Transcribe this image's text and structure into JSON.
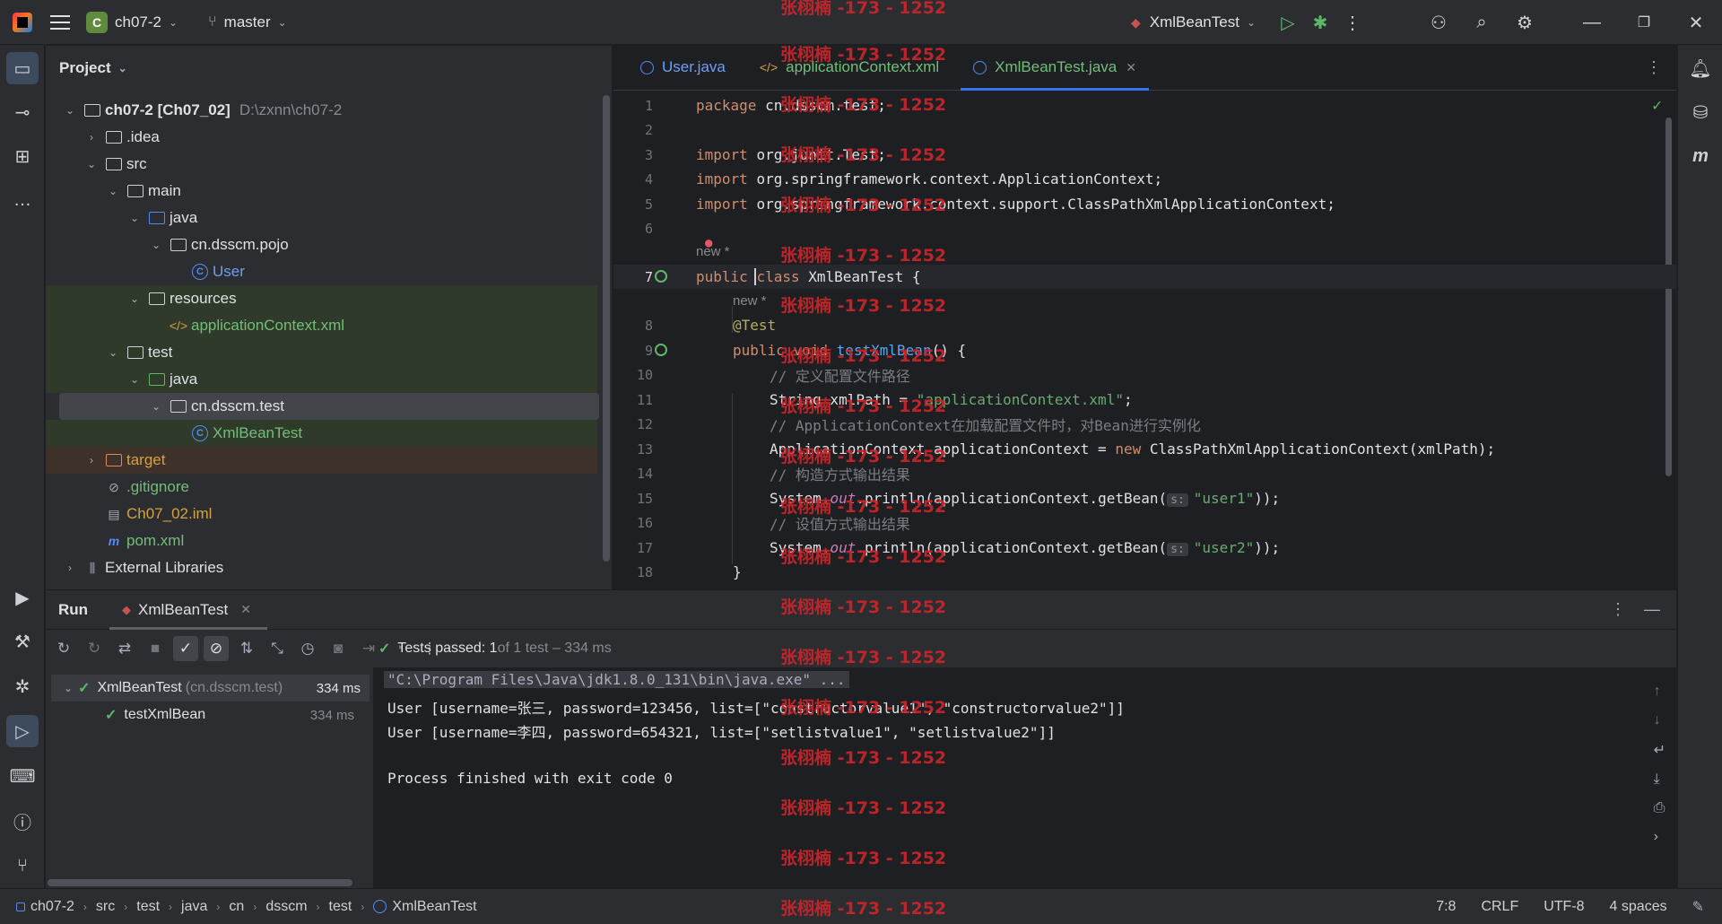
{
  "titlebar": {
    "project_badge": "C",
    "project_name": "ch07-2",
    "branch": "master",
    "run_config": "XmlBeanTest"
  },
  "project_panel": {
    "title": "Project",
    "tree": [
      {
        "label": "ch07-2 [Ch07_02]",
        "extra": "D:\\zxnn\\ch07-2"
      },
      {
        "label": ".idea"
      },
      {
        "label": "src"
      },
      {
        "label": "main"
      },
      {
        "label": "java"
      },
      {
        "label": "cn.dsscm.pojo"
      },
      {
        "label": "User"
      },
      {
        "label": "resources"
      },
      {
        "label": "applicationContext.xml"
      },
      {
        "label": "test"
      },
      {
        "label": "java"
      },
      {
        "label": "cn.dsscm.test"
      },
      {
        "label": "XmlBeanTest"
      },
      {
        "label": "target"
      },
      {
        "label": ".gitignore"
      },
      {
        "label": "Ch07_02.iml"
      },
      {
        "label": "pom.xml"
      },
      {
        "label": "External Libraries"
      }
    ]
  },
  "editor": {
    "tabs": [
      {
        "label": "User.java"
      },
      {
        "label": "applicationContext.xml"
      },
      {
        "label": "XmlBeanTest.java"
      }
    ],
    "hint_new": "new *",
    "line_numbers": [
      "1",
      "2",
      "3",
      "4",
      "5",
      "6",
      "7",
      "8",
      "9",
      "10",
      "11",
      "12",
      "13",
      "14",
      "15",
      "16",
      "17",
      "18"
    ],
    "lines": {
      "l1a": "package ",
      "l1b": "cn.dsscm.test;",
      "l3a": "import ",
      "l3b": "org.junit.Test;",
      "l4a": "import ",
      "l4b": "org.springframework.context.ApplicationContext;",
      "l5a": "import ",
      "l5b": "org.springframework.context.support.ClassPathXmlApplicationContext;",
      "l7a": "public ",
      "l7b": "class ",
      "l7c": "XmlBeanTest {",
      "l8": "@Test",
      "l9a": "public ",
      "l9b": "void ",
      "l9c": "testXmlBean",
      "l9d": "() {",
      "l10": "// 定义配置文件路径",
      "l11a": "String xmlPath = ",
      "l11b": "\"applicationContext.xml\"",
      "l11c": ";",
      "l12": "// ApplicationContext在加载配置文件时，对Bean进行实例化",
      "l13a": "ApplicationContext applicationContext = ",
      "l13b": "new ",
      "l13c": "ClassPathXmlApplicationContext(xmlPath);",
      "l14": "// 构造方式输出结果",
      "l15a": "System.",
      "l15b": "out",
      "l15c": ".println(applicationContext.getBean(",
      "l15d": "s:",
      "l15e": "\"user1\"",
      "l15f": "));",
      "l16": "// 设值方式输出结果",
      "l17a": "System.",
      "l17b": "out",
      "l17c": ".println(applicationContext.getBean(",
      "l17d": "s:",
      "l17e": "\"user2\"",
      "l17f": "));",
      "l18": "}"
    }
  },
  "run_panel": {
    "title": "Run",
    "tab": "XmlBeanTest",
    "summary_bold": "Tests passed: 1",
    "summary_rest": " of 1 test – 334 ms",
    "tests": [
      {
        "name": "XmlBeanTest",
        "pkg": "(cn.dsscm.test)",
        "time": "334 ms"
      },
      {
        "name": "testXmlBean",
        "time": "334 ms"
      }
    ],
    "console": [
      "\"C:\\Program Files\\Java\\jdk1.8.0_131\\bin\\java.exe\" ...",
      "User [username=张三, password=123456, list=[\"constructorvalue1\", \"constructorvalue2\"]]",
      "User [username=李四, password=654321, list=[\"setlistvalue1\", \"setlistvalue2\"]]",
      "",
      "Process finished with exit code 0"
    ]
  },
  "statusbar": {
    "breadcrumbs": [
      "ch07-2",
      "src",
      "test",
      "java",
      "cn",
      "dsscm",
      "test",
      "XmlBeanTest"
    ],
    "position": "7:8",
    "line_sep": "CRLF",
    "encoding": "UTF-8",
    "indent": "4 spaces"
  },
  "watermark": "张栩楠 -173 - 1252",
  "colors": {
    "accent": "#3574f0",
    "success": "#5fb865",
    "watermark": "#c9262b"
  }
}
